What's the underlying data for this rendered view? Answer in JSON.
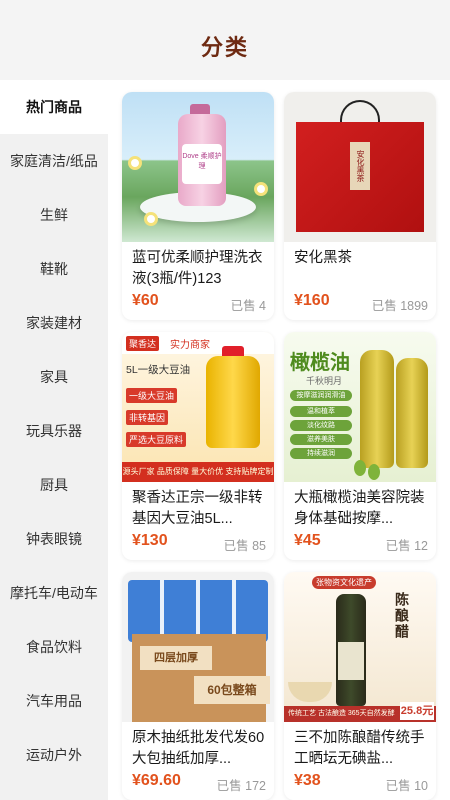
{
  "header": {
    "title": "分类"
  },
  "sidebar": {
    "items": [
      {
        "label": "热门商品",
        "active": true
      },
      {
        "label": "家庭清洁/纸品"
      },
      {
        "label": "生鲜"
      },
      {
        "label": "鞋靴"
      },
      {
        "label": "家装建材"
      },
      {
        "label": "家具"
      },
      {
        "label": "玩具乐器"
      },
      {
        "label": "厨具"
      },
      {
        "label": "钟表眼镜"
      },
      {
        "label": "摩托车/电动车"
      },
      {
        "label": "食品饮料"
      },
      {
        "label": "汽车用品"
      },
      {
        "label": "运动户外"
      }
    ]
  },
  "products": [
    {
      "title": "蓝可优柔顺护理洗衣液(3瓶/件)123",
      "price": "¥60",
      "sold": "已售 4",
      "image_text": {
        "label": "Dove 柔顺护理"
      }
    },
    {
      "title": "安化黑茶",
      "price": "¥160",
      "sold": "已售 1899",
      "image_text": {
        "tag": "安化黑茶"
      }
    },
    {
      "title": "聚香达正宗一级非转基因大豆油5L...",
      "price": "¥130",
      "sold": "已售 85",
      "image_text": {
        "brand": "聚香达",
        "merchant": "实力商家",
        "line1": "5L一级大豆油",
        "tags": [
          "一级大豆油",
          "非转基因",
          "严选大豆原料"
        ],
        "bottom": "源头厂家 品质保障 量大价优 支持贴牌定制一件代发"
      }
    },
    {
      "title": "大瓶橄榄油美容院装身体基础按摩...",
      "price": "¥45",
      "sold": "已售 12",
      "image_text": {
        "head": "橄榄油",
        "sub": "千秋明月",
        "bars": [
          "按摩滋润润滑油",
          "温和植萃",
          "淡化纹路",
          "滋养美肤",
          "持续滋润"
        ]
      }
    },
    {
      "title": "原木抽纸批发代发60大包抽纸加厚...",
      "price": "¥69.60",
      "sold": "已售 172",
      "image_text": {
        "stripe1": "四层加厚",
        "stripe2": "60包整箱"
      }
    },
    {
      "title": "三不加陈酿醋传统手工晒坛无碘盐...",
      "price": "¥38",
      "sold": "已售 10",
      "image_text": {
        "topline": "张物资文化遗产",
        "vtitle": "陈酿醋",
        "footer": "传统工艺 古法酿造 365天自然发酵",
        "badge": "25.8元"
      }
    }
  ],
  "colors": {
    "price": "#e2521d",
    "title": "#6e2a12"
  }
}
